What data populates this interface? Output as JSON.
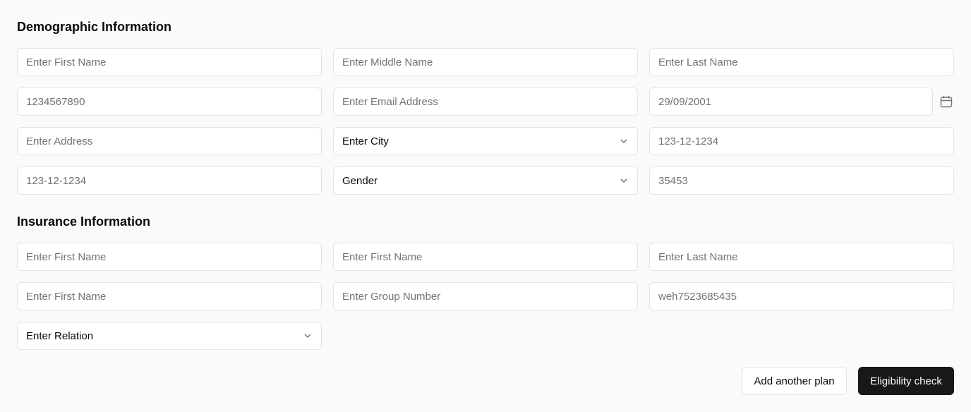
{
  "demographic": {
    "title": "Demographic Information",
    "first_name_placeholder": "Enter First Name",
    "middle_name_placeholder": "Enter Middle Name",
    "last_name_placeholder": "Enter Last Name",
    "phone_placeholder": "1234567890",
    "email_placeholder": "Enter Email Address",
    "dob_value": "29/09/2001",
    "address_placeholder": "Enter Address",
    "city_select": "Enter City",
    "ssn_placeholder": "123-12-1234",
    "ssn2_placeholder": "123-12-1234",
    "gender_select": "Gender",
    "zip_placeholder": "35453"
  },
  "insurance": {
    "title": "Insurance Information",
    "r1c1_placeholder": "Enter First Name",
    "r1c2_placeholder": "Enter First Name",
    "r1c3_placeholder": "Enter Last Name",
    "r2c1_placeholder": "Enter First Name",
    "group_number_placeholder": "Enter Group Number",
    "member_id_placeholder": "weh7523685435",
    "relation_select": "Enter Relation"
  },
  "actions": {
    "add_plan_label": "Add another plan",
    "eligibility_label": "Eligibility check"
  },
  "colors": {
    "border": "#e4e4e7",
    "placeholder": "#71717a",
    "primary": "#18181b"
  },
  "icons": {
    "chevron": "chevron-down-icon",
    "calendar": "calendar-icon"
  }
}
